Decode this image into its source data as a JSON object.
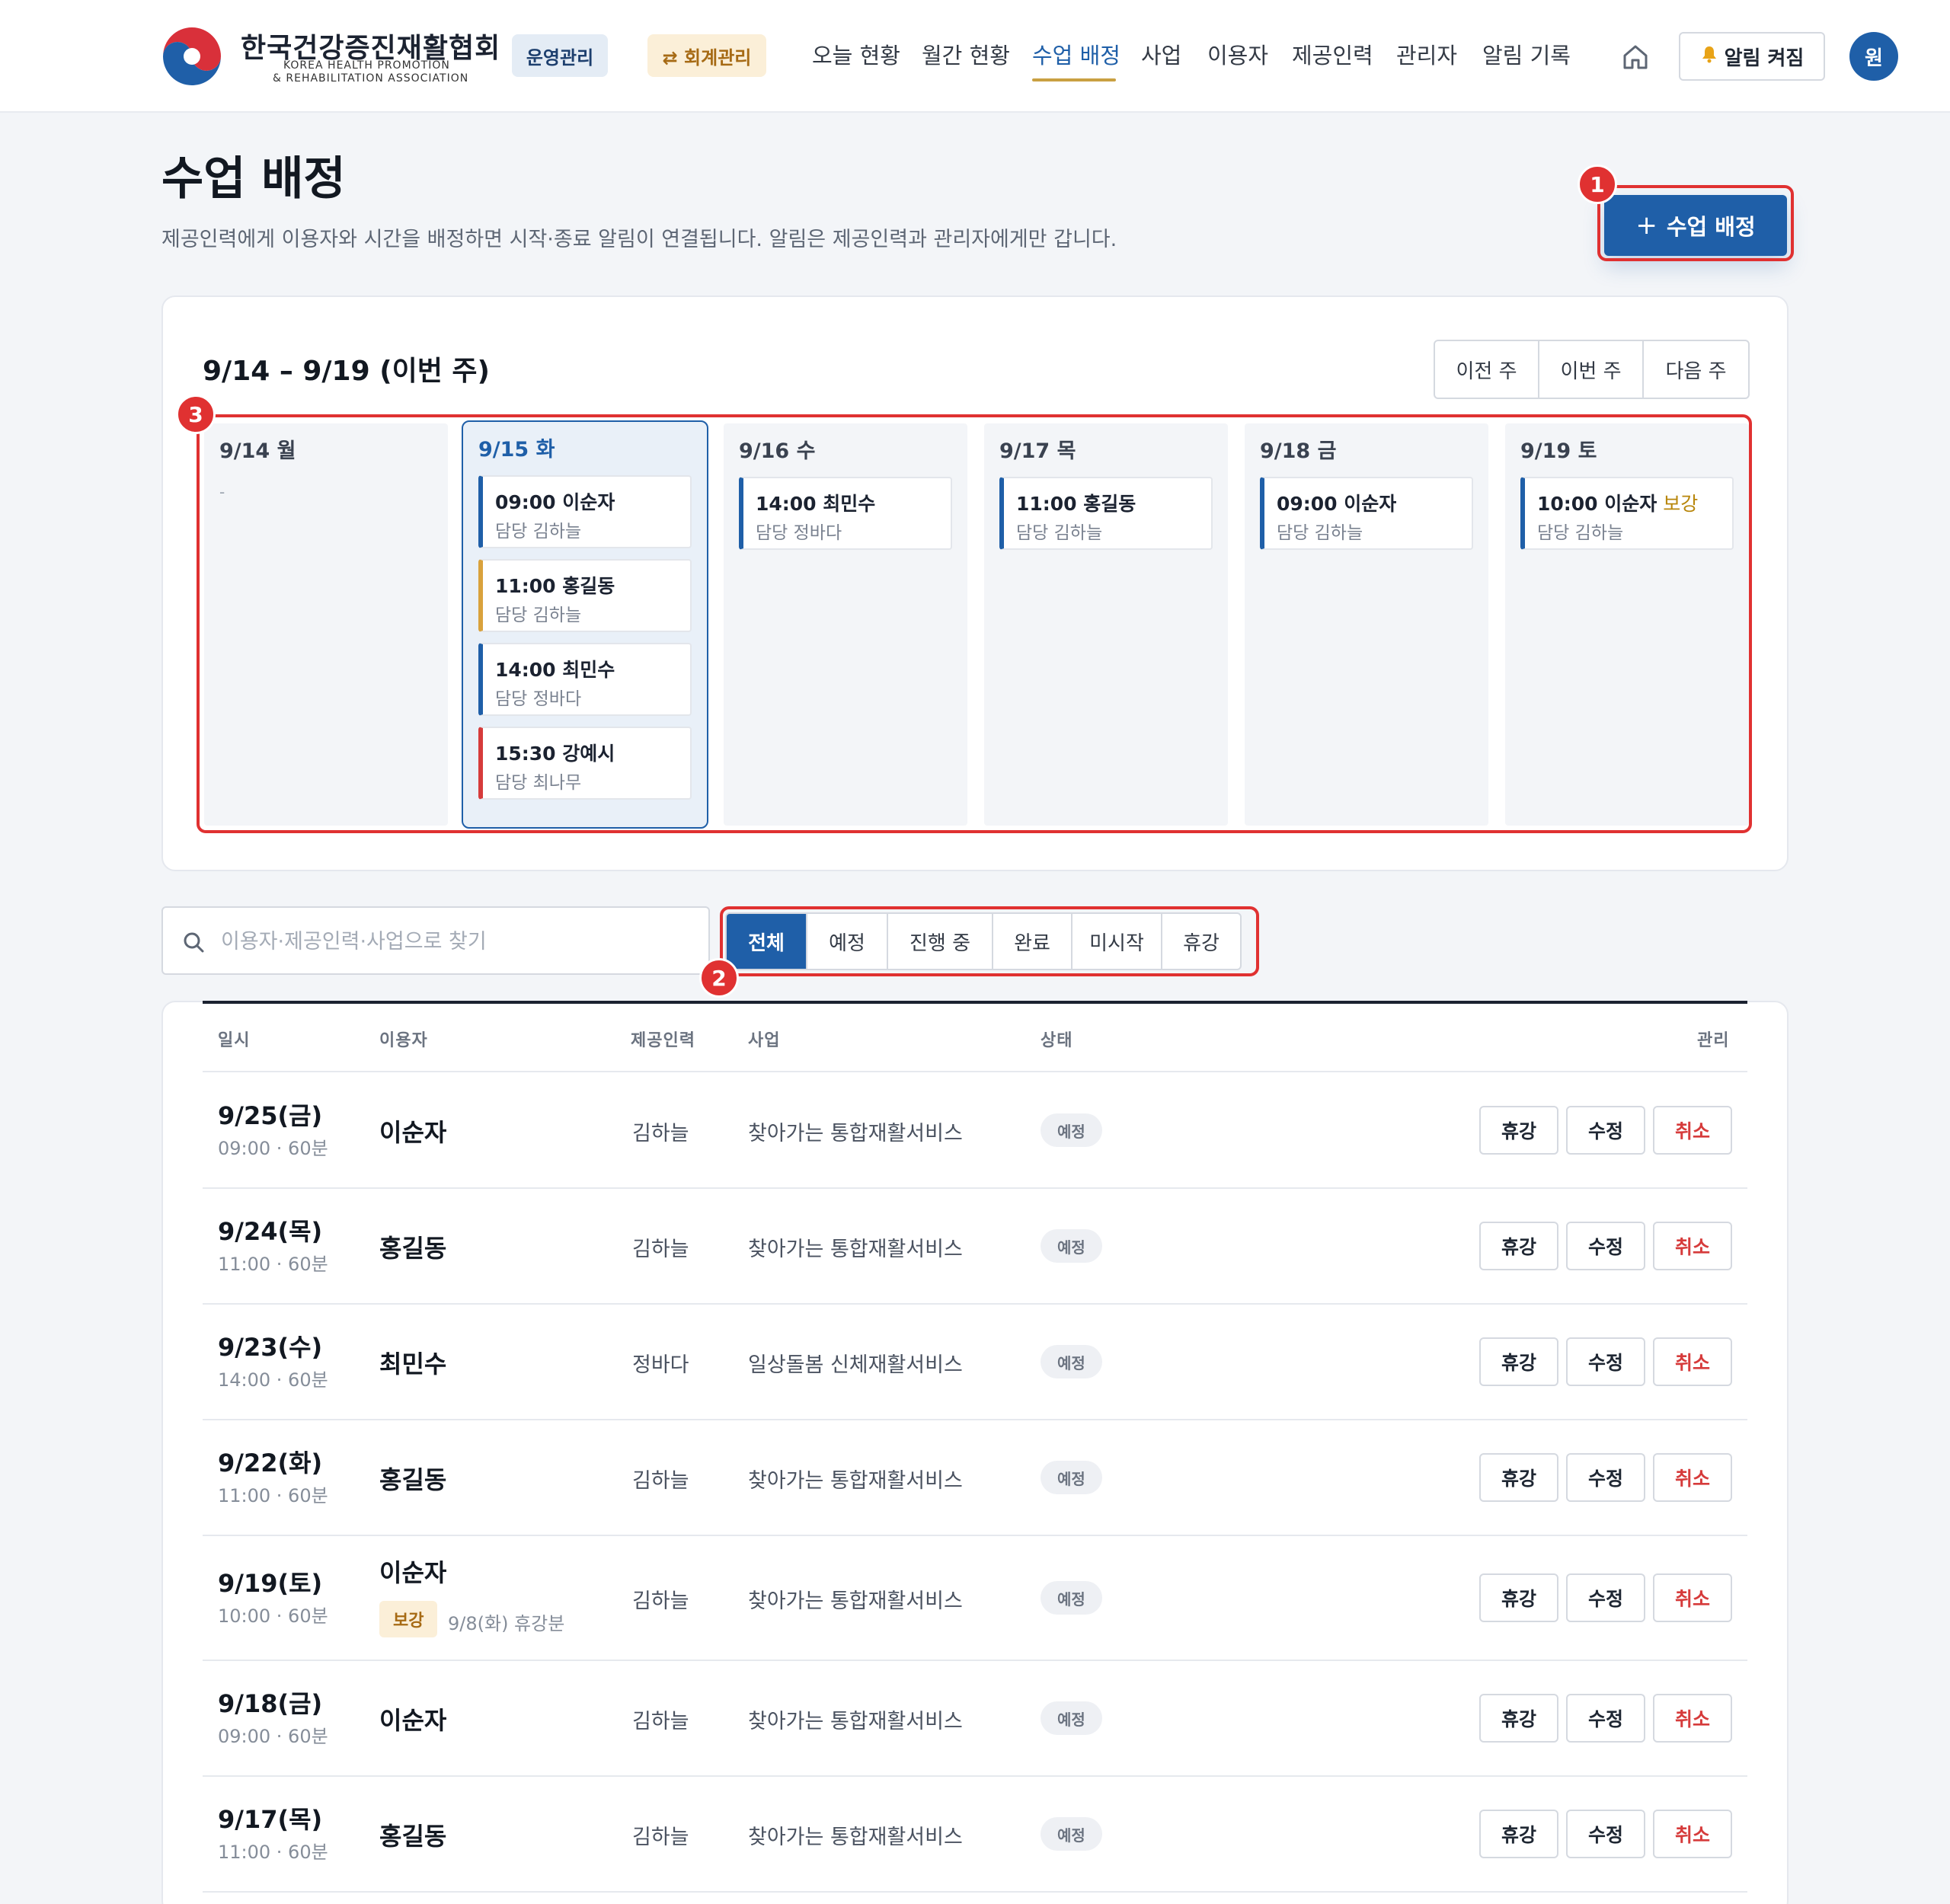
{
  "header": {
    "logo_ko": "한국건강증진재활협회",
    "logo_en_line1": "KOREA HEALTH PROMOTION",
    "logo_en_line2": "& REHABILITATION ASSOCIATION",
    "chip_ops": "운영관리",
    "chip_accounting": "⇄ 회계관리",
    "nav": [
      "오늘 현황",
      "월간 현황",
      "수업 배정",
      "사업",
      "이용자",
      "제공인력",
      "관리자",
      "알림 기록"
    ],
    "active_nav": "수업 배정",
    "alarm_label": "알림 켜짐",
    "avatar": "원"
  },
  "page": {
    "title": "수업 배정",
    "description": "제공인력에게 이용자와 시간을 배정하면 시작·종료 알림이 연결됩니다. 알림은 제공인력과 관리자에게만 갑니다.",
    "primary_button": "수업 배정"
  },
  "annotations": [
    "1",
    "2",
    "3"
  ],
  "week": {
    "title": "9/14 – 9/19 (이번 주)",
    "nav": [
      "이전 주",
      "이번 주",
      "다음 주"
    ],
    "days": [
      {
        "label": "9/14 월",
        "empty": "-",
        "events": []
      },
      {
        "label": "9/15 화",
        "events": [
          {
            "title": "09:00 이순자",
            "sub": "담당 김하늘",
            "color": "#1f5fa8"
          },
          {
            "title": "11:00 홍길동",
            "sub": "담당 김하늘",
            "color": "#d9a23c"
          },
          {
            "title": "14:00 최민수",
            "sub": "담당 정바다",
            "color": "#1f5fa8"
          },
          {
            "title": "15:30 강예시",
            "sub": "담당 최나무",
            "color": "#d63b3b"
          }
        ]
      },
      {
        "label": "9/16 수",
        "events": [
          {
            "title": "14:00 최민수",
            "sub": "담당 정바다",
            "color": "#1f5fa8"
          }
        ]
      },
      {
        "label": "9/17 목",
        "events": [
          {
            "title": "11:00 홍길동",
            "sub": "담당 김하늘",
            "color": "#1f5fa8"
          }
        ]
      },
      {
        "label": "9/18 금",
        "events": [
          {
            "title": "09:00 이순자",
            "sub": "담당 김하늘",
            "color": "#1f5fa8"
          }
        ]
      },
      {
        "label": "9/19 토",
        "events": [
          {
            "title": "10:00 이순자",
            "tag": "보강",
            "sub": "담당 김하늘",
            "color": "#1f5fa8"
          }
        ]
      }
    ]
  },
  "filters": {
    "search_placeholder": "이용자·제공인력·사업으로 찾기",
    "tabs": [
      "전체",
      "예정",
      "진행 중",
      "완료",
      "미시작",
      "휴강"
    ],
    "active_tab": "전체"
  },
  "table": {
    "headers": [
      "일시",
      "이용자",
      "제공인력",
      "사업",
      "상태",
      "관리"
    ],
    "actions": [
      "휴강",
      "수정",
      "취소"
    ],
    "rows": [
      {
        "date": "9/25(금)",
        "time": "09:00 · 60분",
        "user": "이순자",
        "provider": "김하늘",
        "program": "찾아가는 통합재활서비스",
        "status": "예정"
      },
      {
        "date": "9/24(목)",
        "time": "11:00 · 60분",
        "user": "홍길동",
        "provider": "김하늘",
        "program": "찾아가는 통합재활서비스",
        "status": "예정"
      },
      {
        "date": "9/23(수)",
        "time": "14:00 · 60분",
        "user": "최민수",
        "provider": "정바다",
        "program": "일상돌봄 신체재활서비스",
        "status": "예정"
      },
      {
        "date": "9/22(화)",
        "time": "11:00 · 60분",
        "user": "홍길동",
        "provider": "김하늘",
        "program": "찾아가는 통합재활서비스",
        "status": "예정"
      },
      {
        "date": "9/19(토)",
        "time": "10:00 · 60분",
        "user": "이순자",
        "makeup_badge": "보강",
        "makeup_note": "9/8(화) 휴강분",
        "provider": "김하늘",
        "program": "찾아가는 통합재활서비스",
        "status": "예정"
      },
      {
        "date": "9/18(금)",
        "time": "09:00 · 60분",
        "user": "이순자",
        "provider": "김하늘",
        "program": "찾아가는 통합재활서비스",
        "status": "예정"
      },
      {
        "date": "9/17(목)",
        "time": "11:00 · 60분",
        "user": "홍길동",
        "provider": "김하늘",
        "program": "찾아가는 통합재활서비스",
        "status": "예정"
      }
    ]
  },
  "colors": {
    "primary": "#1f5fa8",
    "accent_gold": "#c9a042",
    "danger": "#d63b3b",
    "annotation_red": "#e03131"
  }
}
